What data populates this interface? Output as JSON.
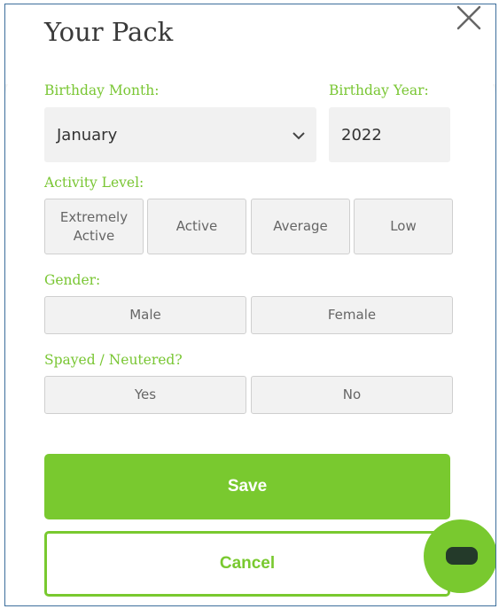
{
  "header": {
    "title": "Your Pack"
  },
  "birthday": {
    "month_label": "Birthday Month:",
    "month_value": "January",
    "year_label": "Birthday Year:",
    "year_value": "2022"
  },
  "activity": {
    "label": "Activity Level:",
    "options": [
      "Extremely Active",
      "Active",
      "Average",
      "Low"
    ]
  },
  "gender": {
    "label": "Gender:",
    "options": [
      "Male",
      "Female"
    ]
  },
  "spayed": {
    "label": "Spayed / Neutered?",
    "options": [
      "Yes",
      "No"
    ]
  },
  "actions": {
    "save_label": "Save",
    "cancel_label": "Cancel"
  },
  "icons": {
    "close": "close-icon",
    "chevron": "chevron-down-icon",
    "chat": "chat-icon"
  },
  "colors": {
    "accent": "#79c92f",
    "label": "#79c633",
    "field_bg": "#f1f1f1"
  }
}
